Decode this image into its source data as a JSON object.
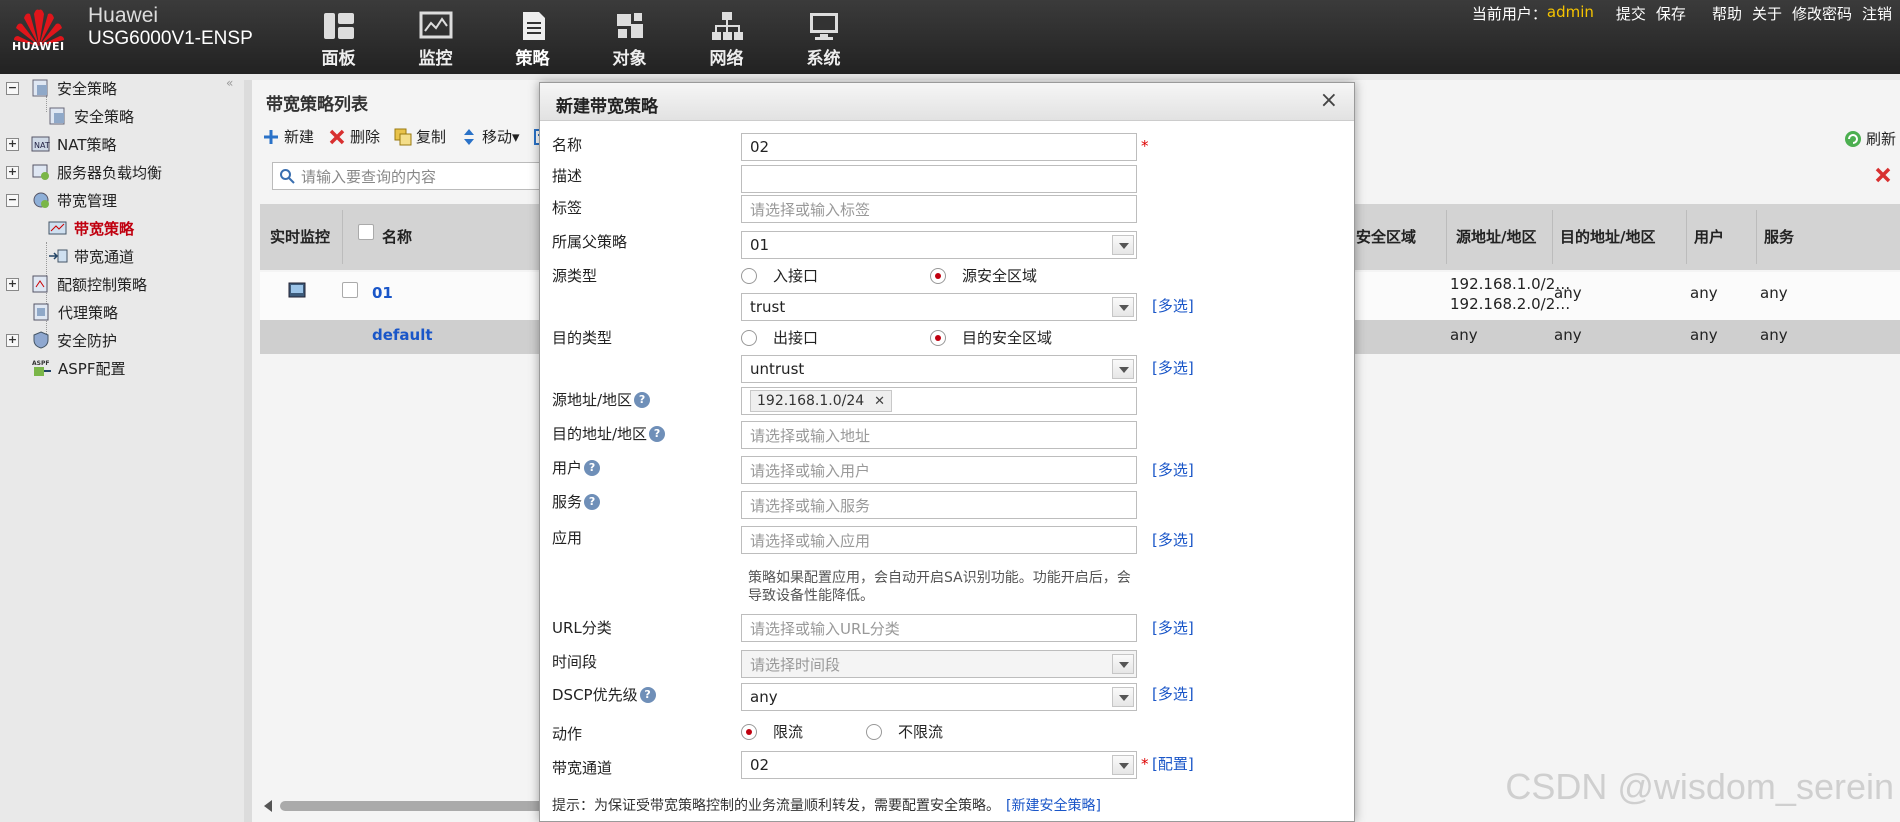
{
  "header": {
    "logo_text": "HUAWEI",
    "brand": "Huawei",
    "model": "USG6000V1-ENSP",
    "nav": [
      "面板",
      "监控",
      "策略",
      "对象",
      "网络",
      "系统"
    ],
    "user_label": "当前用户：",
    "user_name": "admin",
    "actions": [
      "提交",
      "保存",
      "帮助",
      "关于",
      "修改密码",
      "注销"
    ]
  },
  "sidebar": {
    "items": [
      {
        "label": "安全策略",
        "toggle": "−"
      },
      {
        "label": "安全策略"
      },
      {
        "label": "NAT策略",
        "toggle": "+"
      },
      {
        "label": "服务器负载均衡",
        "toggle": "+"
      },
      {
        "label": "带宽管理",
        "toggle": "−"
      },
      {
        "label": "带宽策略",
        "active": true
      },
      {
        "label": "带宽通道"
      },
      {
        "label": "配额控制策略",
        "toggle": "+"
      },
      {
        "label": "代理策略"
      },
      {
        "label": "安全防护",
        "toggle": "+"
      },
      {
        "label": "ASPF配置"
      }
    ],
    "collapse": "«"
  },
  "panel": {
    "title": "带宽策略列表",
    "toolbar": [
      "新建",
      "删除",
      "复制",
      "移动▾"
    ],
    "refresh": "刷新",
    "search_placeholder": "请输入要查询的内容",
    "columns": {
      "monitor": "实时监控",
      "name": "名称",
      "src_zone": "安全区域",
      "src_addr": "源地址/地区",
      "dst_addr": "目的地址/地区",
      "user": "用户",
      "service": "服务"
    },
    "rows": [
      {
        "name": "01",
        "src_addr": [
          "192.168.1.0/2…",
          "192.168.2.0/2…"
        ],
        "dst_addr": "any",
        "user": "any",
        "service": "any"
      },
      {
        "name": "default",
        "src_addr": [
          "any"
        ],
        "dst_addr": "any",
        "user": "any",
        "service": "any"
      }
    ]
  },
  "dialog": {
    "title": "新建带宽策略",
    "close": "×",
    "fields": {
      "name": {
        "label": "名称",
        "value": "02"
      },
      "desc": {
        "label": "描述",
        "value": ""
      },
      "tag": {
        "label": "标签",
        "placeholder": "请选择或输入标签"
      },
      "parent": {
        "label": "所属父策略",
        "value": "01"
      },
      "src_type": {
        "label": "源类型",
        "opt1": "入接口",
        "opt2": "源安全区域",
        "zone": "trust"
      },
      "dst_type": {
        "label": "目的类型",
        "opt1": "出接口",
        "opt2": "目的安全区域",
        "zone": "untrust"
      },
      "src_addr": {
        "label": "源地址/地区",
        "tag": "192.168.1.0/24"
      },
      "dst_addr": {
        "label": "目的地址/地区",
        "placeholder": "请选择或输入地址"
      },
      "user": {
        "label": "用户",
        "placeholder": "请选择或输入用户"
      },
      "service": {
        "label": "服务",
        "placeholder": "请选择或输入服务"
      },
      "app": {
        "label": "应用",
        "placeholder": "请选择或输入应用"
      },
      "url": {
        "label": "URL分类",
        "placeholder": "请选择或输入URL分类"
      },
      "time": {
        "label": "时间段",
        "placeholder": "请选择时间段"
      },
      "dscp": {
        "label": "DSCP优先级",
        "value": "any"
      },
      "action": {
        "label": "动作",
        "opt1": "限流",
        "opt2": "不限流"
      },
      "channel": {
        "label": "带宽通道",
        "value": "02"
      }
    },
    "app_note": "策略如果配置应用，会自动开启SA识别功能。功能开启后，会导致设备性能降低。",
    "multi": "[多选]",
    "config": "[配置]",
    "required": "*",
    "tip": "提示：为保证受带宽策略控制的业务流量顺利转发，需要配置安全策略。",
    "tip_link": "[新建安全策略]"
  },
  "watermark": "CSDN @wisdom_serein"
}
